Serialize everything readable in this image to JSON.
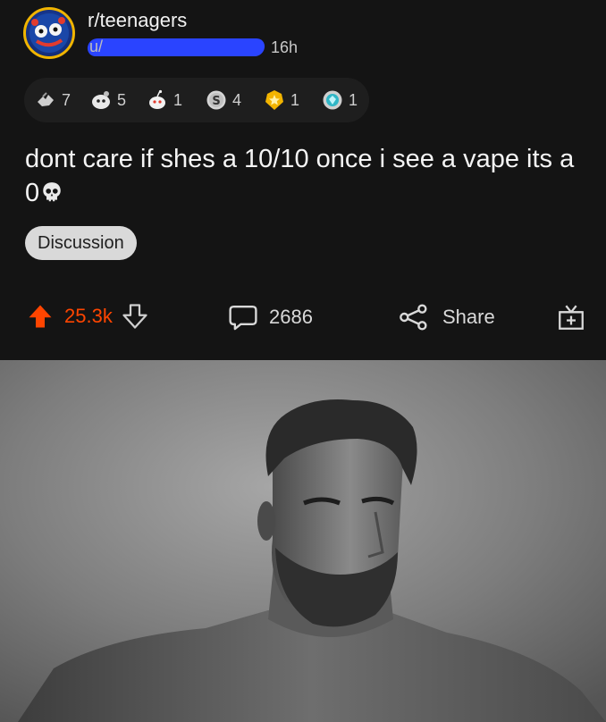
{
  "post": {
    "subreddit": "r/teenagers",
    "username_prefix": "u/",
    "time_ago": "16h",
    "awards": [
      {
        "icon": "wholesome-hands-award-icon",
        "count": "7"
      },
      {
        "icon": "helpful-award-icon",
        "count": "5"
      },
      {
        "icon": "snoo-award-icon",
        "count": "1"
      },
      {
        "icon": "silver-coin-award-icon",
        "count": "4"
      },
      {
        "icon": "gold-star-award-icon",
        "count": "1"
      },
      {
        "icon": "diamond-badge-award-icon",
        "count": "1"
      }
    ],
    "title": "dont care if shes a 10/10 once i see a vape its a 0",
    "title_emoji": "skull-icon",
    "flair": "Discussion"
  },
  "actions": {
    "upvotes": "25.3k",
    "comments": "2686",
    "share_label": "Share",
    "gift_icon": "gift-award-icon"
  },
  "colors": {
    "background": "#141414",
    "upvote_active": "#ff4500",
    "redaction": "#2a44ff",
    "flair_bg": "#d9d9d9",
    "avatar_border": "#f0b400"
  },
  "image": {
    "description_icon": "portrait-photo"
  }
}
